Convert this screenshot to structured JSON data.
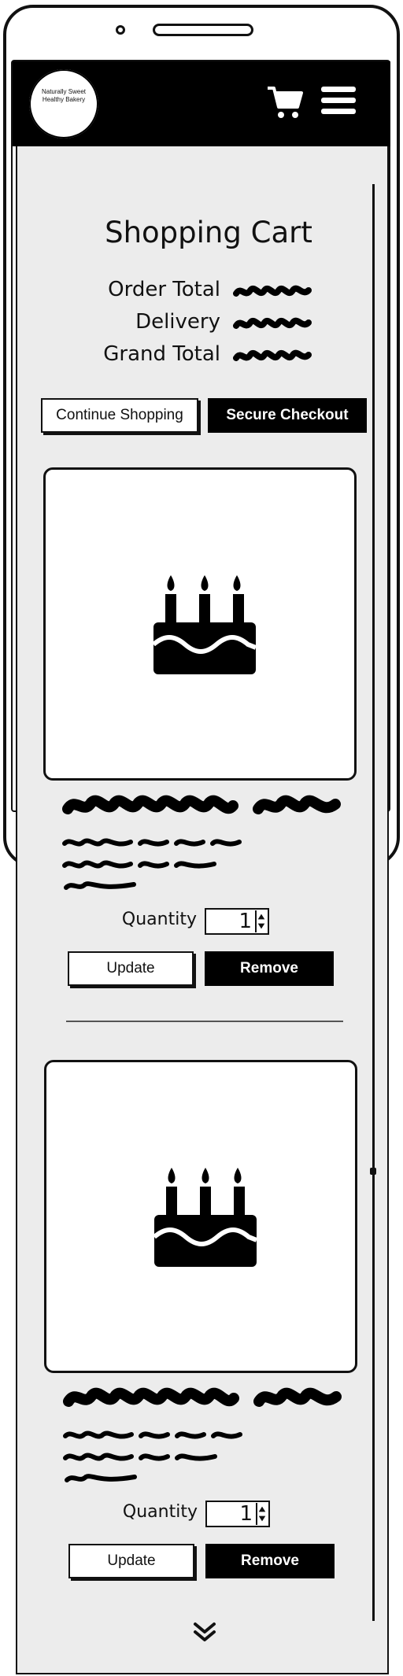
{
  "app": {
    "logo_text": "Naturally Sweet Healthy Bakery"
  },
  "header": {
    "cart_icon": "cart-icon",
    "menu_icon": "hamburger-menu-icon"
  },
  "page": {
    "title": "Shopping Cart"
  },
  "summary": {
    "order_total_label": "Order Total",
    "delivery_label": "Delivery",
    "grand_total_label": "Grand Total"
  },
  "actions": {
    "continue_label": "Continue Shopping",
    "checkout_label": "Secure Checkout"
  },
  "items": [
    {
      "image_icon": "birthday-cake-icon",
      "quantity_label": "Quantity",
      "quantity": "1",
      "update_label": "Update",
      "remove_label": "Remove"
    },
    {
      "image_icon": "birthday-cake-icon",
      "quantity_label": "Quantity",
      "quantity": "1",
      "update_label": "Update",
      "remove_label": "Remove"
    }
  ],
  "colors": {
    "header_bg": "#000000",
    "page_bg": "#ececec",
    "primary_button": "#000000"
  }
}
